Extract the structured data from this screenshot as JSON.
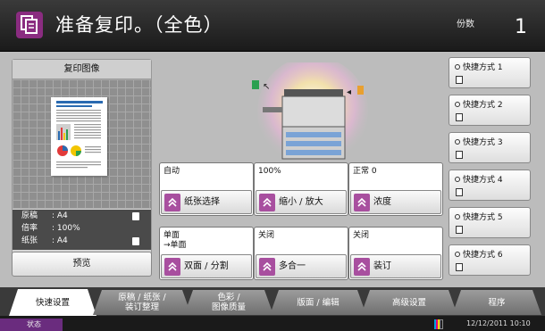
{
  "header": {
    "title": "准备复印。（全色）",
    "copies_label": "份数",
    "copies_value": "1",
    "app_icon": "copy-document-icon"
  },
  "preview": {
    "title": "复印图像",
    "rows": [
      {
        "key": "原稿",
        "value": ": A4"
      },
      {
        "key": "倍率",
        "value": ": 100%"
      },
      {
        "key": "纸张",
        "value": ": A4"
      }
    ],
    "button": "预览"
  },
  "functions": [
    {
      "value": "自动",
      "label": "纸张选择"
    },
    {
      "value": "100%",
      "label": "缩小 / 放大"
    },
    {
      "value": "正常 0",
      "label": "浓度"
    },
    {
      "value": "单面\n→单面",
      "label": "双面 / 分割"
    },
    {
      "value": "关闭",
      "label": "多合一"
    },
    {
      "value": "关闭",
      "label": "装订"
    }
  ],
  "shortcuts": [
    "快捷方式 1",
    "快捷方式 2",
    "快捷方式 3",
    "快捷方式 4",
    "快捷方式 5",
    "快捷方式 6"
  ],
  "tabs": [
    {
      "label": "快速设置",
      "active": true
    },
    {
      "label": "原稿 / 纸张 /\n装订整理",
      "active": false
    },
    {
      "label": "色彩 /\n图像质量",
      "active": false
    },
    {
      "label": "版面 / 编辑",
      "active": false
    },
    {
      "label": "高级设置",
      "active": false
    },
    {
      "label": "程序",
      "active": false
    }
  ],
  "status": {
    "label": "状态",
    "datetime": "12/12/2011  10:10"
  },
  "colors": {
    "accent": "#a84f9f",
    "header": "#2a2a2a",
    "main_bg": "#bcbcbc"
  }
}
